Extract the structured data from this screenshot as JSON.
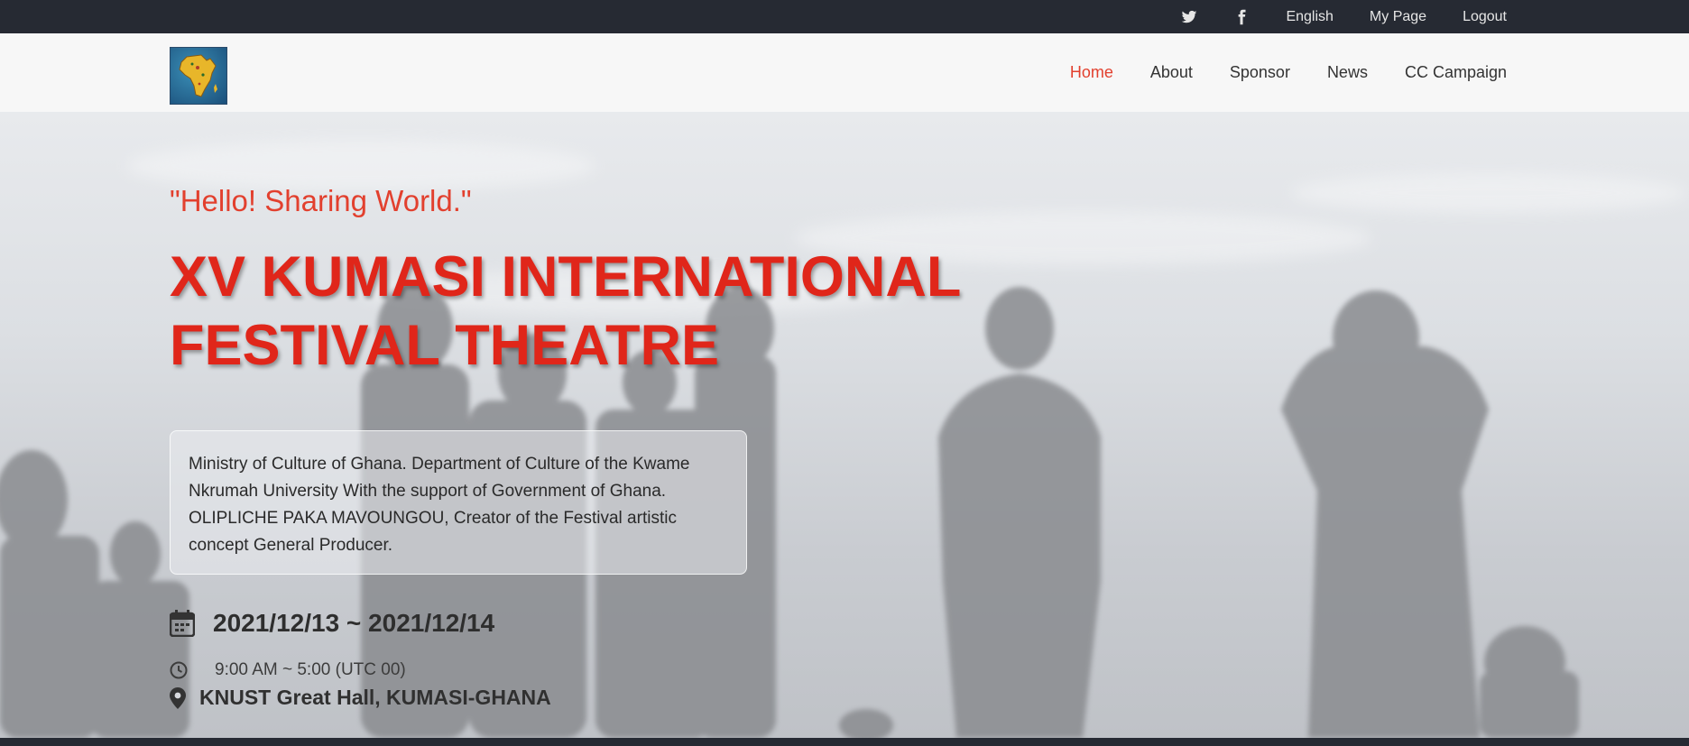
{
  "topbar": {
    "language": "English",
    "mypage": "My Page",
    "logout": "Logout",
    "icons": [
      "twitter-icon",
      "facebook-icon"
    ]
  },
  "nav": {
    "items": [
      "Home",
      "About",
      "Sponsor",
      "News",
      "CC Campaign"
    ],
    "active": "Home"
  },
  "hero": {
    "tagline": "\"Hello! Sharing World.\"",
    "title_line1": "XV KUMASI INTERNATIONAL",
    "title_line2": "FESTIVAL THEATRE",
    "description": "Ministry of Culture of Ghana. Department of Culture of the Kwame Nkrumah University With the support of Government of Ghana. OLIPLICHE PAKA MAVOUNGOU, Creator of the Festival artistic concept General Producer.",
    "date": "2021/12/13 ~ 2021/12/14",
    "time": "9:00 AM ~ 5:00 (UTC 00)",
    "location": "KNUST Great Hall, KUMASI-GHANA"
  },
  "colors": {
    "accent": "#e2402e",
    "title": "#e0261a",
    "topbar_bg": "#262a33",
    "navbar_bg": "#f7f7f7"
  }
}
